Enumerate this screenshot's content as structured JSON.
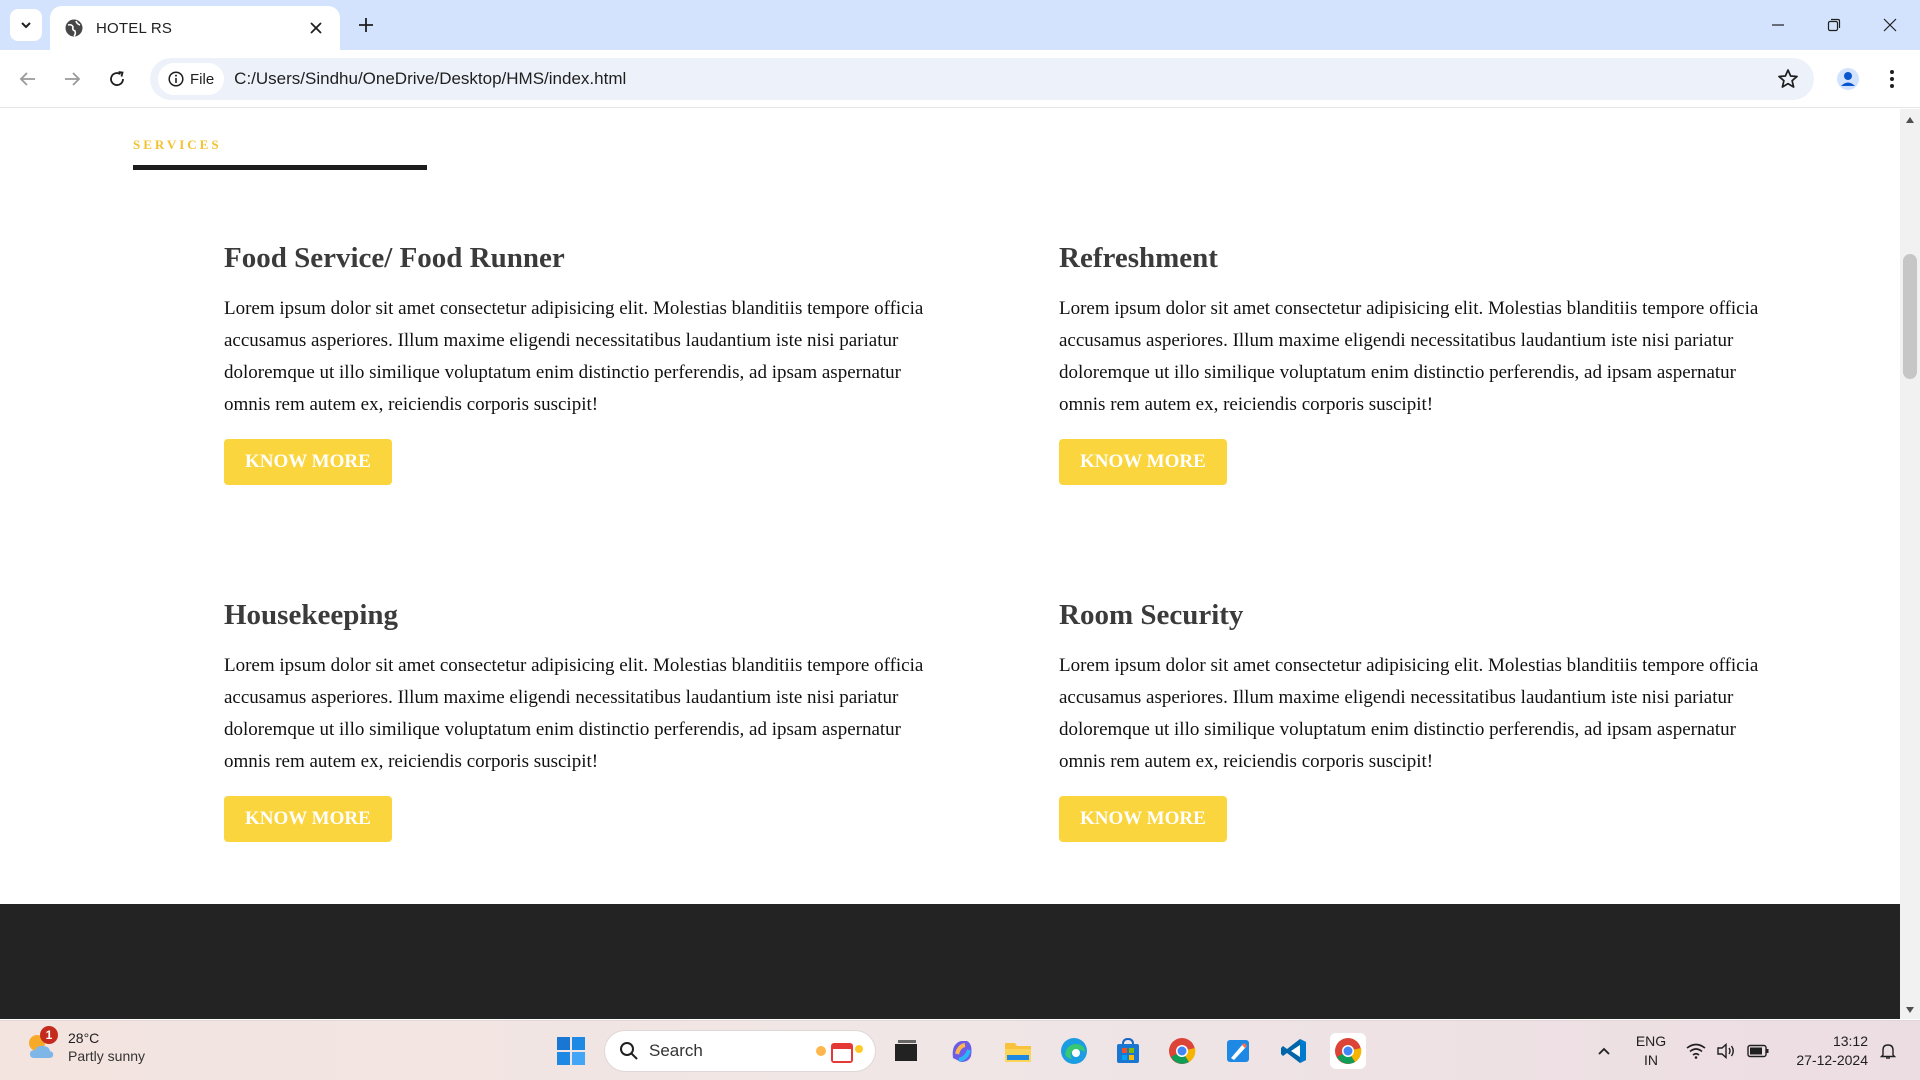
{
  "browser": {
    "tab_title": "HOTEL RS",
    "chip_label": "File",
    "url": "C:/Users/Sindhu/OneDrive/Desktop/HMS/index.html"
  },
  "page": {
    "section_label": "SERVICES",
    "services": [
      {
        "title": "Food Service/ Food Runner",
        "text": "Lorem ipsum dolor sit amet consectetur adipisicing elit. Molestias blanditiis tempore officia accusamus asperiores. Illum maxime eligendi necessitatibus laudantium iste nisi pariatur doloremque ut illo similique voluptatum enim distinctio perferendis, ad ipsam aspernatur omnis rem autem ex, reiciendis corporis suscipit!",
        "button": "KNOW MORE"
      },
      {
        "title": "Refreshment",
        "text": "Lorem ipsum dolor sit amet consectetur adipisicing elit. Molestias blanditiis tempore officia accusamus asperiores. Illum maxime eligendi necessitatibus laudantium iste nisi pariatur doloremque ut illo similique voluptatum enim distinctio perferendis, ad ipsam aspernatur omnis rem autem ex, reiciendis corporis suscipit!",
        "button": "KNOW MORE"
      },
      {
        "title": "Housekeeping",
        "text": "Lorem ipsum dolor sit amet consectetur adipisicing elit. Molestias blanditiis tempore officia accusamus asperiores. Illum maxime eligendi necessitatibus laudantium iste nisi pariatur doloremque ut illo similique voluptatum enim distinctio perferendis, ad ipsam aspernatur omnis rem autem ex, reiciendis corporis suscipit!",
        "button": "KNOW MORE"
      },
      {
        "title": "Room Security",
        "text": "Lorem ipsum dolor sit amet consectetur adipisicing elit. Molestias blanditiis tempore officia accusamus asperiores. Illum maxime eligendi necessitatibus laudantium iste nisi pariatur doloremque ut illo similique voluptatum enim distinctio perferendis, ad ipsam aspernatur omnis rem autem ex, reiciendis corporis suscipit!",
        "button": "KNOW MORE"
      }
    ]
  },
  "taskbar": {
    "weather_temp": "28°C",
    "weather_condition": "Partly sunny",
    "weather_badge": "1",
    "search_label": "Search",
    "lang_primary": "ENG",
    "lang_secondary": "IN",
    "time": "13:12",
    "date": "27-12-2024"
  },
  "colors": {
    "accent_yellow": "#fad53d",
    "label_yellow": "#f2c230",
    "tabbar_blue": "#d3e3fd",
    "footer_dark": "#232323"
  },
  "icons": {
    "tab_search": "chevron-down-icon",
    "tab_favicon": "globe-icon",
    "tab_close": "close-icon",
    "new_tab": "plus-icon",
    "minimize": "minimize-icon",
    "restore": "restore-icon",
    "close_window": "close-icon",
    "back": "arrow-left-icon",
    "forward": "arrow-right-icon",
    "reload": "reload-icon",
    "site_info": "info-icon",
    "bookmark": "star-icon",
    "profile": "person-icon",
    "menu": "kebab-icon"
  }
}
